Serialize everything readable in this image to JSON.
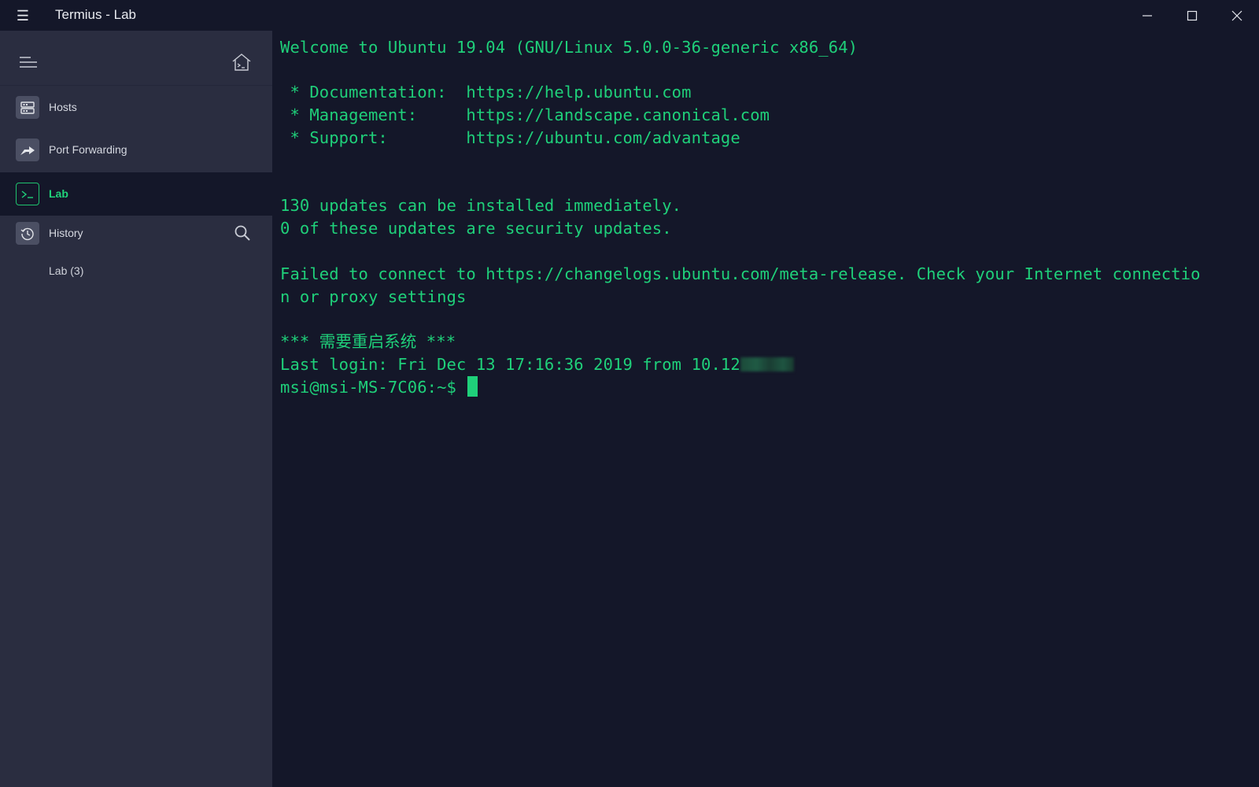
{
  "window": {
    "title": "Termius - Lab",
    "menu_icon": "hamburger-icon",
    "controls": [
      "minimize-icon",
      "maximize-icon",
      "close-icon"
    ]
  },
  "sidebar": {
    "items": [
      {
        "label": "Hosts",
        "icon": "server-icon",
        "active": false
      },
      {
        "label": "Port Forwarding",
        "icon": "forward-arrow-icon",
        "active": false
      },
      {
        "label": "Lab",
        "icon": "terminal-prompt-icon",
        "active": true
      },
      {
        "label": "History",
        "icon": "history-clock-icon",
        "active": false
      }
    ],
    "history_entries": [
      "Lab (3)"
    ]
  },
  "terminal": {
    "lines": [
      "Welcome to Ubuntu 19.04 (GNU/Linux 5.0.0-36-generic x86_64)",
      "",
      " * Documentation:  https://help.ubuntu.com",
      " * Management:     https://landscape.canonical.com",
      " * Support:        https://ubuntu.com/advantage",
      "",
      "",
      "130 updates can be installed immediately.",
      "0 of these updates are security updates.",
      "",
      "Failed to connect to https://changelogs.ubuntu.com/meta-release. Check your Internet connectio",
      "n or proxy settings",
      "",
      "*** 需要重启系统 ***",
      "Last login: Fri Dec 13 17:16:36 2019 from 10.12",
      "msi@msi-MS-7C06:~$ "
    ],
    "text_color": "#1fd07a",
    "background": "#141729"
  },
  "colors": {
    "sidebar_bg": "#2a2d40",
    "accent": "#20d47a"
  }
}
